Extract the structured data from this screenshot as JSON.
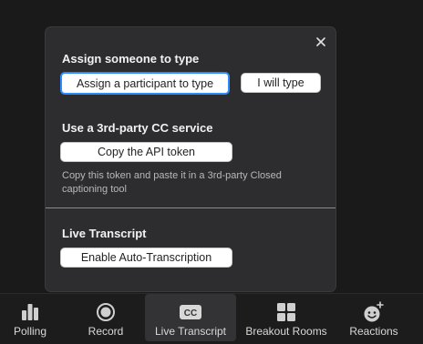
{
  "popup": {
    "assign": {
      "title": "Assign someone to type",
      "assign_participant_label": "Assign a participant to type",
      "i_will_type_label": "I will type"
    },
    "third_party": {
      "title": "Use a 3rd-party CC service",
      "copy_token_label": "Copy the API token",
      "hint": "Copy this token and paste it in a 3rd-party Closed captioning tool"
    },
    "live_transcript": {
      "title": "Live Transcript",
      "enable_label": "Enable Auto-Transcription"
    }
  },
  "toolbar": {
    "items": [
      {
        "label": "Polling",
        "icon": "bar-chart-icon"
      },
      {
        "label": "Record",
        "icon": "record-icon"
      },
      {
        "label": "Live Transcript",
        "icon": "cc-icon",
        "active": true,
        "badge": "CC"
      },
      {
        "label": "Breakout Rooms",
        "icon": "grid-icon"
      },
      {
        "label": "Reactions",
        "icon": "emoji-plus-icon"
      }
    ]
  },
  "colors": {
    "accent": "#2d8cff",
    "popup_bg": "#2d2d2f",
    "toolbar_bg": "#1c1c1c"
  }
}
